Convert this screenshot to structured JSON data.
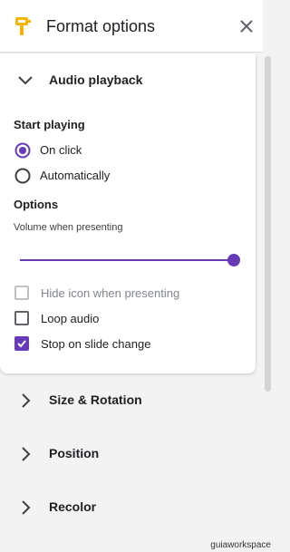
{
  "header": {
    "title": "Format options",
    "icon": "paint-format-icon",
    "close_icon": "close-icon"
  },
  "audio": {
    "section_title": "Audio playback",
    "start_playing_label": "Start playing",
    "options": [
      {
        "label": "On click",
        "selected": true
      },
      {
        "label": "Automatically",
        "selected": false
      }
    ],
    "options_label": "Options",
    "volume_label": "Volume when presenting",
    "volume_level_percent": 100,
    "checkboxes": [
      {
        "label": "Hide icon when presenting",
        "checked": false,
        "disabled": true
      },
      {
        "label": "Loop audio",
        "checked": false,
        "disabled": false
      },
      {
        "label": "Stop on slide change",
        "checked": true,
        "disabled": false
      }
    ]
  },
  "sections": [
    {
      "label": "Size & Rotation"
    },
    {
      "label": "Position"
    },
    {
      "label": "Recolor"
    }
  ],
  "colors": {
    "accent": "#673ab7",
    "icon_yellow": "#f4b400"
  },
  "watermark": "guiaworkspace"
}
